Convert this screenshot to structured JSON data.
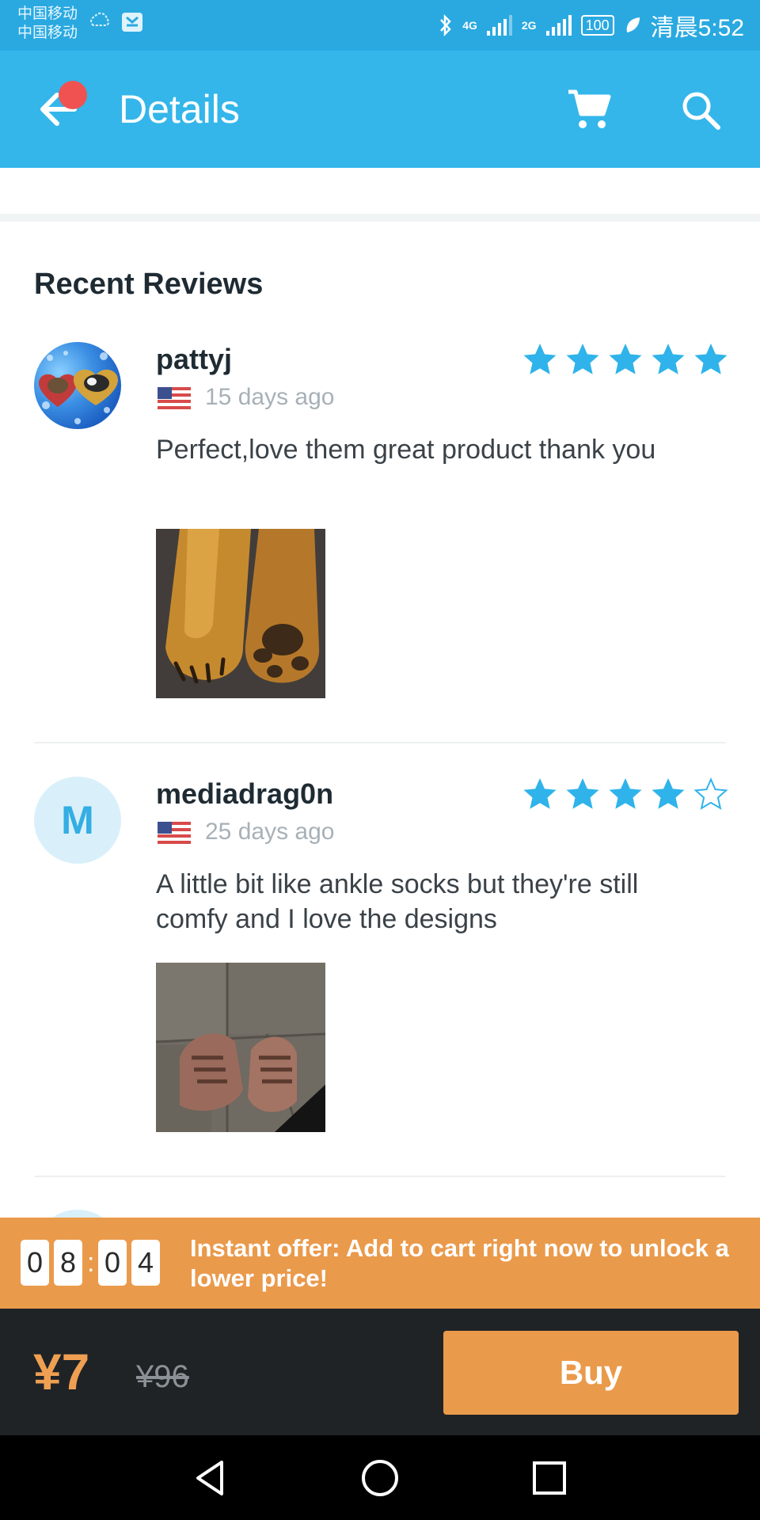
{
  "status_bar": {
    "carrier1": "中国移动",
    "carrier2": "中国移动",
    "network1": "4G",
    "network2": "2G",
    "battery": "100",
    "time": "清晨5:52"
  },
  "header": {
    "title": "Details",
    "accent_color": "#34b6ea",
    "badge_color": "#f05252"
  },
  "reviews": {
    "section_title": "Recent Reviews",
    "items": [
      {
        "username": "pattyj",
        "date": "15 days ago",
        "rating": 5,
        "text": "Perfect,love them great product thank you"
      },
      {
        "avatar_letter": "M",
        "username": "mediadrag0n",
        "date": "25 days ago",
        "rating": 4,
        "text": "A little bit like ankle socks but they're still comfy and I love the designs"
      }
    ]
  },
  "offer": {
    "timer_digits": [
      "0",
      "8",
      "0",
      "4"
    ],
    "text": "Instant offer: Add to cart right now to unlock a lower price!",
    "color": "#ea9a4b"
  },
  "purchase": {
    "price": "¥7",
    "old_price": "¥96",
    "buy_label": "Buy"
  },
  "star_color": "#2fb3ea"
}
